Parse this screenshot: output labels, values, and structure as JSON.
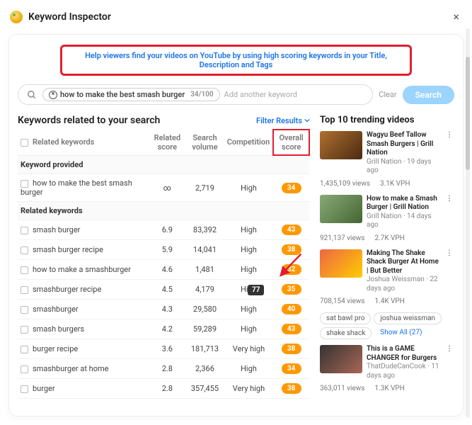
{
  "header": {
    "title": "Keyword Inspector",
    "close": "×"
  },
  "banner": "Help viewers find your videos on YouTube by using high scoring keywords in your Title, Description and Tags",
  "search": {
    "chip_text": "how to make the best smash burger",
    "chip_count": "34/100",
    "placeholder": "Add another keyword",
    "clear": "Clear",
    "button": "Search"
  },
  "left": {
    "title": "Keywords related to your search",
    "filter": "Filter Results",
    "columns": {
      "c1": "Related keywords",
      "c2": "Related score",
      "c3": "Search volume",
      "c4": "Competition",
      "c5": "Overall score"
    },
    "sub1": "Keyword provided",
    "sub2": "Related keywords",
    "tooltip": "77",
    "rows": [
      {
        "kw": "how to make the best smash burger",
        "score": "∞",
        "vol": "2,719",
        "comp": "High",
        "overall": "34"
      },
      {
        "kw": "smash burger",
        "score": "6.9",
        "vol": "83,392",
        "comp": "High",
        "overall": "43"
      },
      {
        "kw": "smash burger recipe",
        "score": "5.9",
        "vol": "14,041",
        "comp": "High",
        "overall": "38"
      },
      {
        "kw": "how to make a smashburger",
        "score": "4.6",
        "vol": "1,481",
        "comp": "High",
        "overall": "32"
      },
      {
        "kw": "smashburger recipe",
        "score": "4.5",
        "vol": "4,179",
        "comp": "High",
        "overall": "35"
      },
      {
        "kw": "smashburger",
        "score": "4.3",
        "vol": "29,580",
        "comp": "High",
        "overall": "40"
      },
      {
        "kw": "smash burgers",
        "score": "4.2",
        "vol": "59,289",
        "comp": "High",
        "overall": "43"
      },
      {
        "kw": "burger recipe",
        "score": "3.6",
        "vol": "181,713",
        "comp": "Very high",
        "overall": "38"
      },
      {
        "kw": "smashburger at home",
        "score": "2.8",
        "vol": "2,366",
        "comp": "High",
        "overall": "34"
      },
      {
        "kw": "burger",
        "score": "2.8",
        "vol": "357,455",
        "comp": "Very high",
        "overall": "38"
      }
    ]
  },
  "right": {
    "title": "Top 10 trending videos",
    "videos": [
      {
        "title": "Wagyu Beef Tallow Smash Burgers | Grill Nation",
        "channel": "Grill Nation · 19 days ago",
        "views": "1,435,109 views",
        "vph": "3.1K VPH"
      },
      {
        "title": "How to make a Smash Burger | Grill Nation",
        "channel": "Grill Nation · 14 days ago",
        "views": "921,137 views",
        "vph": "2.7K VPH"
      },
      {
        "title": "Making The Shake Shack Burger At Home | But Better",
        "channel": "Joshua Weissman · 22 days ago",
        "views": "708,154 views",
        "vph": "1.4K VPH"
      },
      {
        "title": "This is a GAME CHANGER for Burgers",
        "channel": "ThatDudeCanCook · 11 days ago",
        "views": "363,011 views",
        "vph": "1.3K VPH"
      }
    ],
    "tags": [
      "sat bawl pro",
      "joshua weissman",
      "shake shack"
    ],
    "showall": "Show All (27)"
  }
}
